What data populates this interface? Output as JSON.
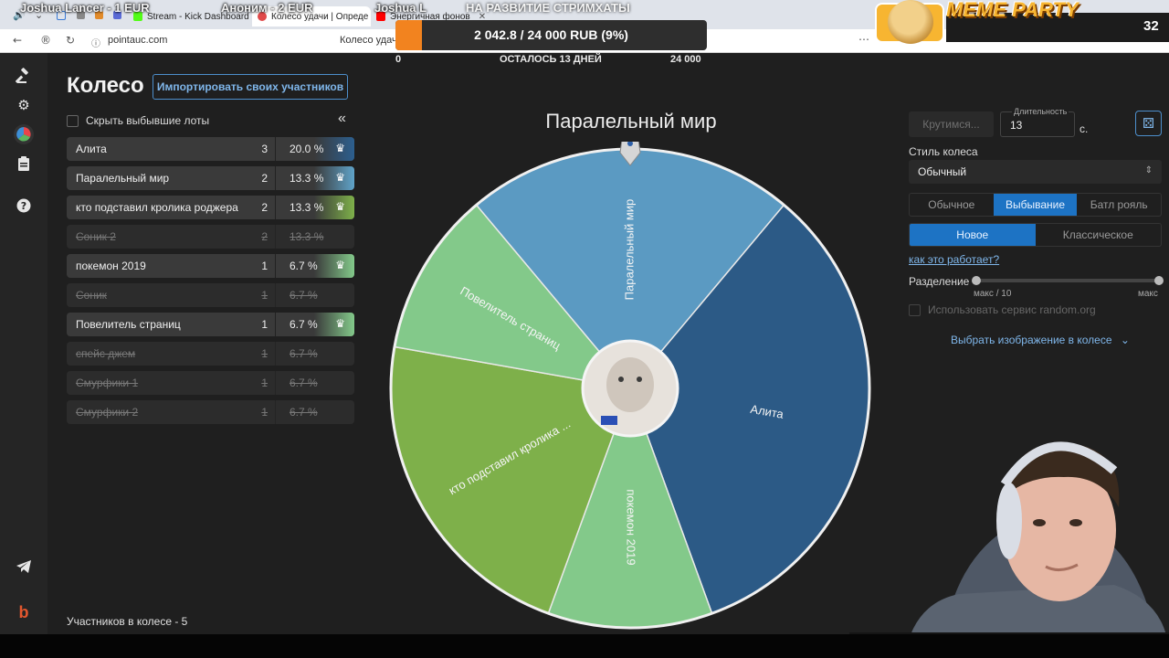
{
  "browser": {
    "tabs": [
      {
        "label": "Stream - Kick Dashboard",
        "color": "#53fc18"
      },
      {
        "label": "Колесо удачи | Опреде",
        "color": "#e04a4a"
      },
      {
        "label": "Энергичная фонов",
        "color": "#ff0000"
      }
    ],
    "url": "pointauc.com",
    "page_title": "Колесо удачи"
  },
  "overlay": {
    "donations": [
      "Joshua Lancer - 1 EUR",
      "Аноним - 2 EUR",
      "Joshua L"
    ],
    "goal_title": "НА РАЗВИТИЕ СТРИМХАТЫ",
    "progress_text": "2 042.8 / 24 000 RUB (9%)",
    "progress_fraction": 0.085,
    "min": "0",
    "remaining": "ОСТАЛОСЬ 13 ДНЕЙ",
    "max": "24 000",
    "meme_party": "MEME PARTY",
    "meme_count": "32"
  },
  "app": {
    "title": "Колесо",
    "import_button": "Импортировать своих участников",
    "hide_dropped_label": "Скрыть выбывшие лоты",
    "lots": [
      {
        "name": "Алита",
        "amount": "3",
        "percent": "20.0 %",
        "color": "#2c5f8f",
        "out": false
      },
      {
        "name": "Паралельный мир",
        "amount": "2",
        "percent": "13.3 %",
        "color": "#5fa3c9",
        "out": false
      },
      {
        "name": "кто подставил кролика роджера",
        "amount": "2",
        "percent": "13.3 %",
        "color": "#7eb04a",
        "out": false
      },
      {
        "name": "Соник 2",
        "amount": "2",
        "percent": "13.3 %",
        "color": "",
        "out": true
      },
      {
        "name": "покемон 2019",
        "amount": "1",
        "percent": "6.7 %",
        "color": "#83c98a",
        "out": false
      },
      {
        "name": "Соник",
        "amount": "1",
        "percent": "6.7 %",
        "color": "",
        "out": true
      },
      {
        "name": "Повелитель страниц",
        "amount": "1",
        "percent": "6.7 %",
        "color": "#83c98a",
        "out": false
      },
      {
        "name": "спейс джем",
        "amount": "1",
        "percent": "6.7 %",
        "color": "",
        "out": true
      },
      {
        "name": "Смурфики 1",
        "amount": "1",
        "percent": "6.7 %",
        "color": "",
        "out": true
      },
      {
        "name": "Смурфики 2",
        "amount": "1",
        "percent": "6.7 %",
        "color": "",
        "out": true
      }
    ],
    "participants_count": "Участников в колесе - 5"
  },
  "wheel": {
    "winner": "Паралельный мир",
    "segments": [
      {
        "label": "Паралельный мир",
        "color": "#5b9ac2"
      },
      {
        "label": "Алита",
        "color": "#2c5a86"
      },
      {
        "label": "покемон 2019",
        "color": "#83c98a"
      },
      {
        "label": "кто подставил кролика ...",
        "color": "#7eb04a"
      },
      {
        "label": "Повелитель страниц",
        "color": "#83c98a"
      }
    ]
  },
  "settings": {
    "spin_button": "Крутимся...",
    "duration_label": "Длительность",
    "duration_value": "13",
    "duration_unit": "с.",
    "style_label": "Стиль колеса",
    "style_value": "Обычный",
    "modes": [
      "Обычное",
      "Выбывание",
      "Батл рояль"
    ],
    "active_mode": "Выбывание",
    "variants": [
      "Новое",
      "Классическое"
    ],
    "active_variant": "Новое",
    "how_link": "как это работает?",
    "split_label": "Разделение",
    "split_min": "макс / 10",
    "split_max": "макс",
    "random_org": "Использовать сервис random.org",
    "choose_image": "Выбрать изображение в колесе"
  }
}
